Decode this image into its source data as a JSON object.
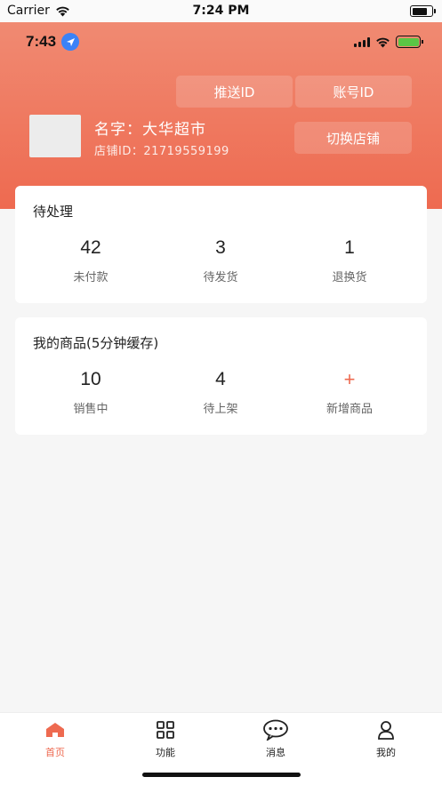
{
  "sim_status": {
    "carrier": "Carrier",
    "time": "7:24 PM"
  },
  "app_status": {
    "time": "7:43"
  },
  "header": {
    "push_id_label": "推送ID",
    "account_id_label": "账号ID",
    "switch_store_label": "切换店铺",
    "store_name": "名字：大华超市",
    "store_id": "店铺ID：21719559199"
  },
  "pending": {
    "title": "待处理",
    "stats": [
      {
        "value": "42",
        "label": "未付款"
      },
      {
        "value": "3",
        "label": "待发货"
      },
      {
        "value": "1",
        "label": "退换货"
      }
    ]
  },
  "goods": {
    "title": "我的商品(5分钟缓存)",
    "stats": [
      {
        "value": "10",
        "label": "销售中"
      },
      {
        "value": "4",
        "label": "待上架"
      },
      {
        "value": "+",
        "label": "新增商品"
      }
    ]
  },
  "tabbar": {
    "items": [
      {
        "label": "首页",
        "icon": "home-icon",
        "active": true
      },
      {
        "label": "功能",
        "icon": "grid-icon"
      },
      {
        "label": "消息",
        "icon": "chat-icon"
      },
      {
        "label": "我的",
        "icon": "user-icon"
      }
    ]
  },
  "colors": {
    "accent": "#ee6a50",
    "header_top": "#f08a72"
  }
}
